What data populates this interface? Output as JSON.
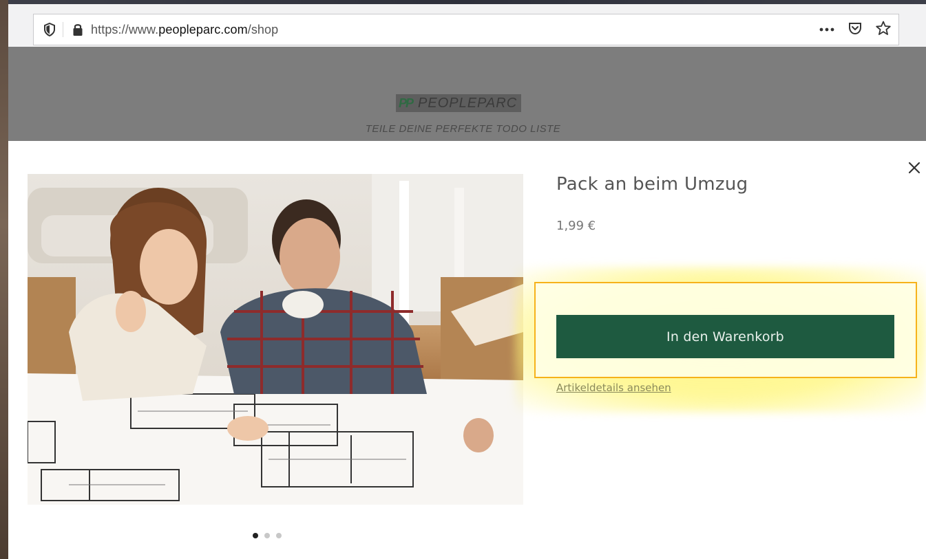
{
  "browser": {
    "url_prefix": "https://www.",
    "url_domain": "peopleparc.com",
    "url_path": "/shop",
    "more_icon": "more-icon",
    "pocket_icon": "pocket-icon",
    "bookmark_icon": "star-icon"
  },
  "site": {
    "logo_mark": "PP",
    "logo_name": "PEOPLEPARC",
    "tagline": "TEILE DEINE PERFEKTE TODO LISTE"
  },
  "product": {
    "title": "Pack an beim Umzug",
    "price": "1,99 €",
    "add_to_cart_label": "In den Warenkorb",
    "details_link_label": "Artikeldetails ansehen",
    "gallery": {
      "current": 1,
      "total": 3
    }
  },
  "colors": {
    "primary_button": "#1e5a40",
    "highlight": "#f6b21a",
    "header_bg": "#7d7d7d"
  }
}
